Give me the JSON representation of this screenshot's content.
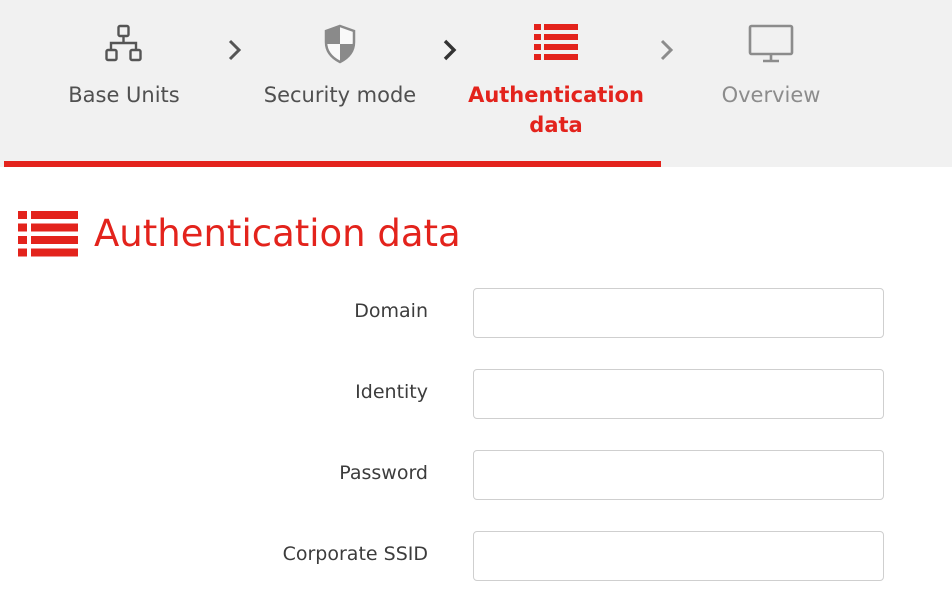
{
  "wizard": {
    "steps": [
      {
        "label": "Base Units",
        "icon": "network-icon",
        "state": "done"
      },
      {
        "label": "Security mode",
        "icon": "shield-icon",
        "state": "done"
      },
      {
        "label": "Authentication data",
        "icon": "list-icon",
        "state": "active"
      },
      {
        "label": "Overview",
        "icon": "monitor-icon",
        "state": "upcoming"
      }
    ]
  },
  "section": {
    "title": "Authentication data",
    "icon": "list-icon"
  },
  "form": {
    "fields": [
      {
        "label": "Domain",
        "value": "",
        "placeholder": ""
      },
      {
        "label": "Identity",
        "value": "",
        "placeholder": ""
      },
      {
        "label": "Password",
        "value": "",
        "placeholder": ""
      },
      {
        "label": "Corporate SSID",
        "value": "",
        "placeholder": ""
      }
    ]
  },
  "colors": {
    "accent": "#e3231c",
    "wizard_background": "#f1f1f1",
    "text": "#505050",
    "muted_text": "#8c8c8c"
  }
}
